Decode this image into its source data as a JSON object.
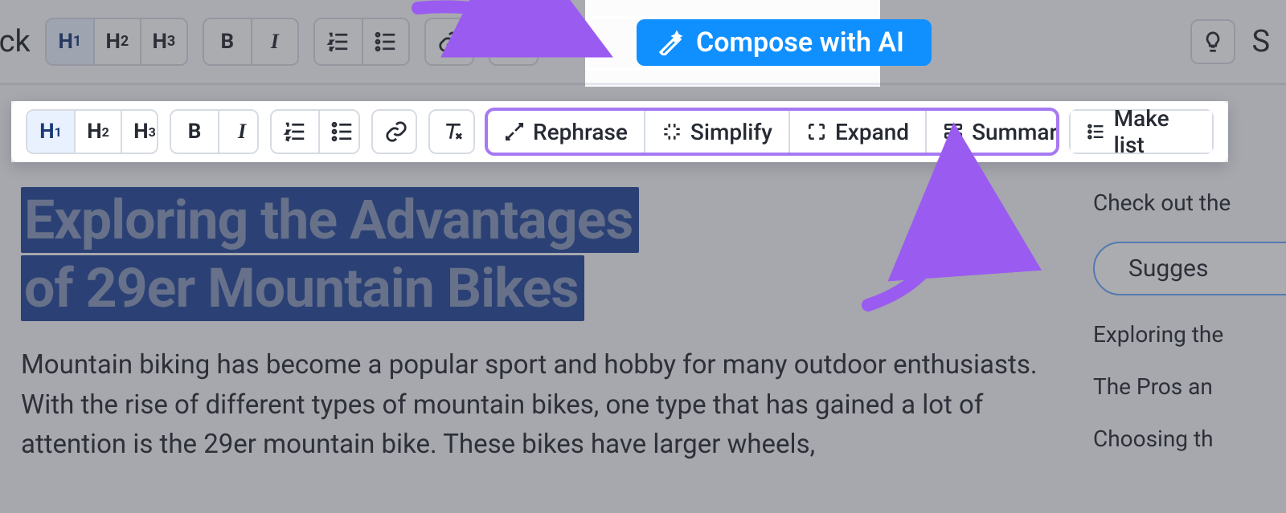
{
  "toolbar": {
    "back_label": "ack",
    "h1": "H",
    "h1s": "1",
    "h2": "H",
    "h2s": "2",
    "h3": "H",
    "h3s": "3",
    "bold": "B",
    "italic": "I",
    "compose_label": "Compose with AI",
    "right_fragment": "S"
  },
  "ctx": {
    "rephrase": "Rephrase",
    "simplify": "Simplify",
    "expand": "Expand",
    "summarize": "Summarize",
    "makelist": "Make list"
  },
  "article": {
    "title_line1": "Exploring the Advantages",
    "title_line2": "of 29er Mountain Bikes",
    "body": "Mountain biking has become a popular sport and hobby for many outdoor enthusiasts. With the rise of different types of mountain bikes, one type that has gained a lot of attention is the 29er mountain bike. These bikes have larger wheels,"
  },
  "side": {
    "checkout": "Check out the",
    "suggest": "Sugges",
    "exploring": "Exploring the",
    "pros": "The Pros an",
    "choosing": "Choosing th"
  }
}
